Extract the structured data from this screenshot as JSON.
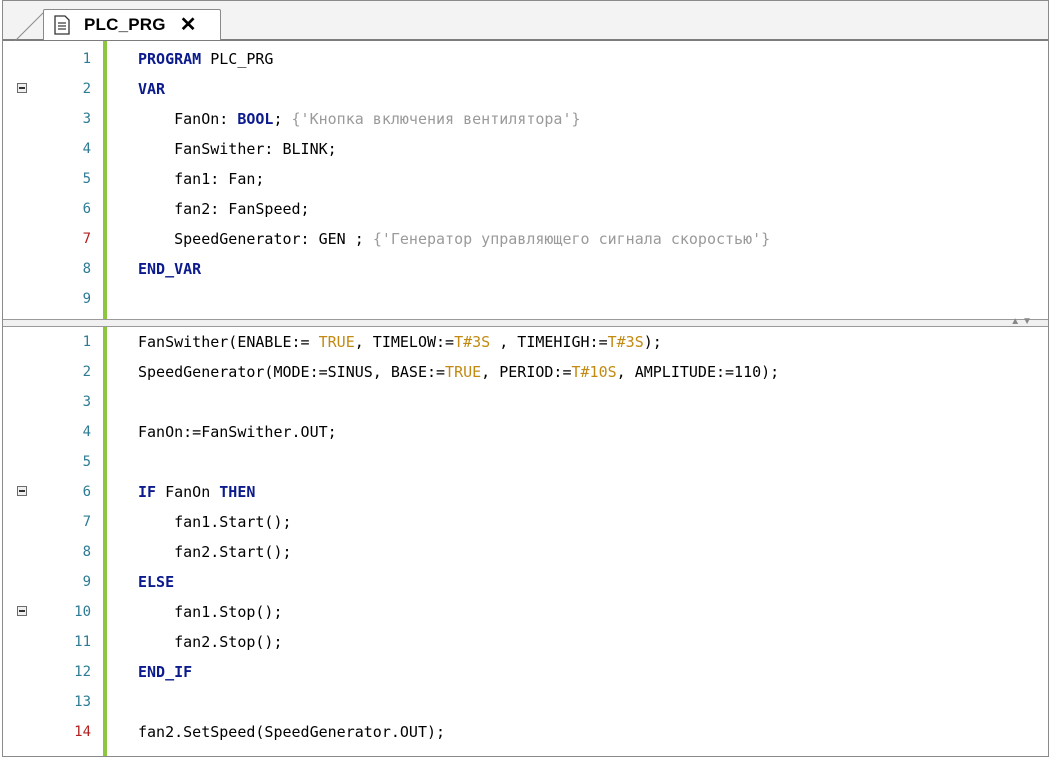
{
  "tab": {
    "title": "PLC_PRG",
    "close": "✕"
  },
  "decl_lines": [
    {
      "n": "1",
      "code": "PROGRAM PLC_PRG"
    },
    {
      "n": "2",
      "code": "VAR"
    },
    {
      "n": "3",
      "code": "    FanOn: BOOL; {'Кнопка включения вентилятора'}"
    },
    {
      "n": "4",
      "code": "    FanSwither: BLINK;"
    },
    {
      "n": "5",
      "code": "    fan1: Fan;"
    },
    {
      "n": "6",
      "code": "    fan2: FanSpeed;"
    },
    {
      "n": "7",
      "code": "    SpeedGenerator: GEN ; {'Генератор управляющего сигнала скоростью'}"
    },
    {
      "n": "8",
      "code": "END_VAR"
    },
    {
      "n": "9",
      "code": ""
    }
  ],
  "impl_lines": [
    {
      "n": "1",
      "code": "FanSwither(ENABLE:= TRUE, TIMELOW:=T#3S , TIMEHIGH:=T#3S);"
    },
    {
      "n": "2",
      "code": "SpeedGenerator(MODE:=SINUS, BASE:=TRUE, PERIOD:=T#10S, AMPLITUDE:=110);"
    },
    {
      "n": "3",
      "code": ""
    },
    {
      "n": "4",
      "code": "FanOn:=FanSwither.OUT;"
    },
    {
      "n": "5",
      "code": ""
    },
    {
      "n": "6",
      "code": "IF FanOn THEN"
    },
    {
      "n": "7",
      "code": "    fan1.Start();"
    },
    {
      "n": "8",
      "code": "    fan2.Start();"
    },
    {
      "n": "9",
      "code": "ELSE"
    },
    {
      "n": "10",
      "code": "    fan1.Stop();"
    },
    {
      "n": "11",
      "code": "    fan2.Stop();"
    },
    {
      "n": "12",
      "code": "END_IF"
    },
    {
      "n": "13",
      "code": ""
    },
    {
      "n": "14",
      "code": "fan2.SetSpeed(SpeedGenerator.OUT);"
    }
  ],
  "colors": {
    "keyword": "#0b1a8c",
    "literal": "#c28a12",
    "comment": "#9a9a9a",
    "line_number": "#2d7b94",
    "line_number_error": "#b22222",
    "gutter_bar": "#8dc63f"
  },
  "icons": {
    "tab": "document-icon",
    "fold": "collapse-minus-icon",
    "splitter": "split-arrows-icon"
  }
}
